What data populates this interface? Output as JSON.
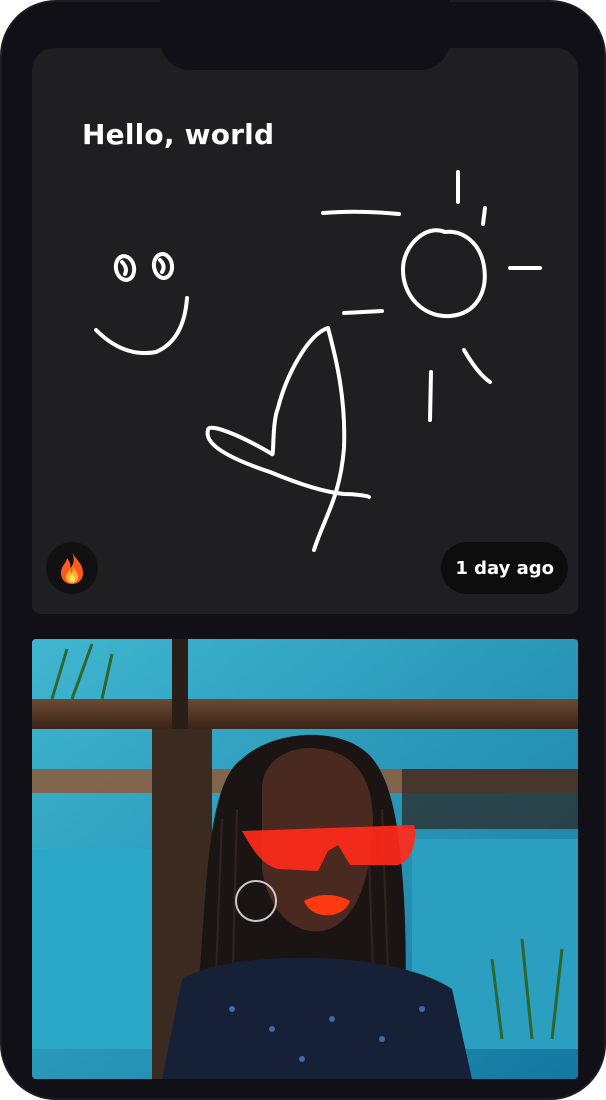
{
  "post": {
    "title": "Hello, world",
    "timestamp": "1 day ago",
    "reaction_icon": "fire-icon",
    "drawing_subjects": [
      "smiley-face",
      "sun",
      "heart"
    ]
  },
  "photo": {
    "subject": "portrait-woman-red-sunglasses"
  },
  "colors": {
    "device": "#111016",
    "card": "#1f1f21",
    "pill": "#0d0d0d",
    "doodle": "#ffffff",
    "fire": "#ff5a1f"
  }
}
